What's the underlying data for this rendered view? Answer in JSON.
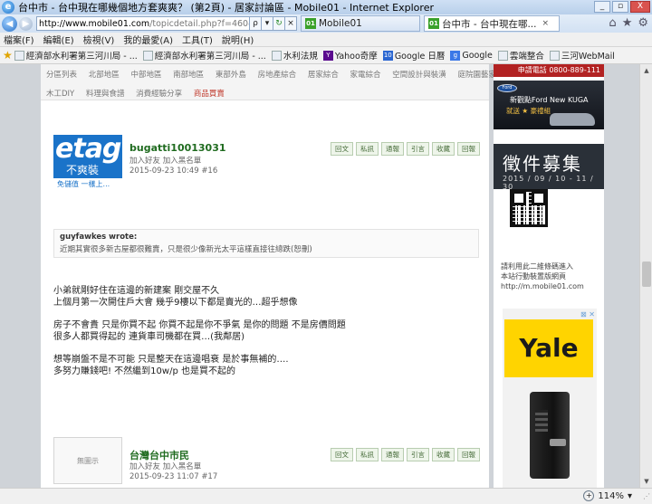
{
  "window": {
    "title": "台中市 - 台中現在哪幾個地方套爽爽？ (第2頁) - 居家討論區 - Mobile01 - Internet Explorer",
    "minimize": "_",
    "restore": "▫",
    "close": "X"
  },
  "nav": {
    "back_glyph": "◀",
    "forward_glyph": "▶",
    "url_host": "http://www.mobile01.com",
    "url_path": "/topicdetail.php?f=460&t=4546504&",
    "search_glyph": "ρ",
    "dropdown_glyph": "▾",
    "go_glyph": "↻",
    "close_glyph": "×",
    "tabs": [
      {
        "label": "Mobile01",
        "favicon": "01",
        "active": false
      },
      {
        "label": "台中市 - 台中現在哪...",
        "favicon": "01",
        "active": true
      }
    ],
    "home_glyph": "⌂",
    "star_glyph": "★",
    "gear_glyph": "⚙"
  },
  "menu": [
    "檔案(F)",
    "編輯(E)",
    "檢視(V)",
    "我的最愛(A)",
    "工具(T)",
    "說明(H)"
  ],
  "favorites": {
    "star_glyph": "★",
    "items": [
      {
        "label": "經濟部水利署第三河川局 - ...",
        "icon": "page"
      },
      {
        "label": "經濟部水利署第三河川局 - ...",
        "icon": "page"
      },
      {
        "label": "水利法規",
        "icon": "page"
      },
      {
        "label": "Yahoo奇摩",
        "icon": "y",
        "glyph": "Y"
      },
      {
        "label": "Google 日曆",
        "icon": "cal",
        "glyph": "10"
      },
      {
        "label": "Google",
        "icon": "g",
        "glyph": "g"
      },
      {
        "label": "雲端整合",
        "icon": "page"
      },
      {
        "label": "三河WebMail",
        "icon": "page"
      }
    ]
  },
  "categories": {
    "row1": [
      "分區列表",
      "北部地區",
      "中部地區",
      "南部地區",
      "東部外島",
      "房地產綜合",
      "居家綜合",
      "家電綜合",
      "空間設計與裝潢",
      "庭院園藝家"
    ],
    "row2": [
      "木工DIY",
      "料理與食譜",
      "消費經驗分享"
    ],
    "row2_highlight": "商品買賣"
  },
  "posts": [
    {
      "username": "bugatti10013031",
      "friend": "加入好友",
      "blacklist": "加入黑名單",
      "datetime": "2015-09-23 10:49",
      "num": "#16",
      "avatar_big": "etag",
      "avatar_sub": "不爽裝",
      "avatar_strip": "免儲值 一樣上...",
      "actions": [
        "回文",
        "私訊",
        "通報",
        "引言",
        "收藏",
        "回報"
      ],
      "quote_header": "guyfawkes wrote:",
      "quote_text": "近期其實很多新古屋都很難賣，只是很少像新光太平這樣直接往總跌(恕刪)",
      "lines": [
        "小弟就剛好住在這邊的新建案 剛交屋不久",
        "上個月第一次開住戶大會 幾乎9樓以下都是賣光的…超乎想像",
        "",
        "房子不會貴 只是你買不起 你買不起是你不爭氣 是你的問題 不是房價問題",
        "很多人都買得起的 連貨車司機都在買…(我鄰居)",
        "",
        "想等崩盤不是不可能 只是整天在這邊唱衰 是於事無補的….",
        "多努力賺錢吧! 不然繼到10w/p 也是買不起的"
      ]
    },
    {
      "username": "台灣台中市民",
      "friend": "加入好友",
      "blacklist": "加入黑名單",
      "datetime": "2015-09-23 11:07",
      "num": "#17",
      "avatar_none": "無圖示",
      "actions": [
        "回文",
        "私訊",
        "通報",
        "引言",
        "收藏",
        "回報"
      ]
    }
  ],
  "sidebar": {
    "phone_ad": "申請電話 0800-889-111",
    "ford_logo": "Ford",
    "ford_line1": "新觀點Ford New KUGA",
    "ford_line2": "就送 ★ 豪禮組",
    "recruit_title": "徵件募集",
    "recruit_date": "2015 / 09 / 10 - 11 / 30",
    "qr_lines": [
      "請利用此二維條碼進入",
      "本站行動裝置版網頁",
      "http://m.mobile01.com"
    ],
    "yale_logo": "Yale",
    "ad_close": "⊠ ✕"
  },
  "scroll": {
    "up": "▲",
    "down": "▼"
  },
  "status": {
    "zoom": "114%",
    "zoom_glyph": "+",
    "dropdown_glyph": "▾",
    "grip": "⋰"
  }
}
